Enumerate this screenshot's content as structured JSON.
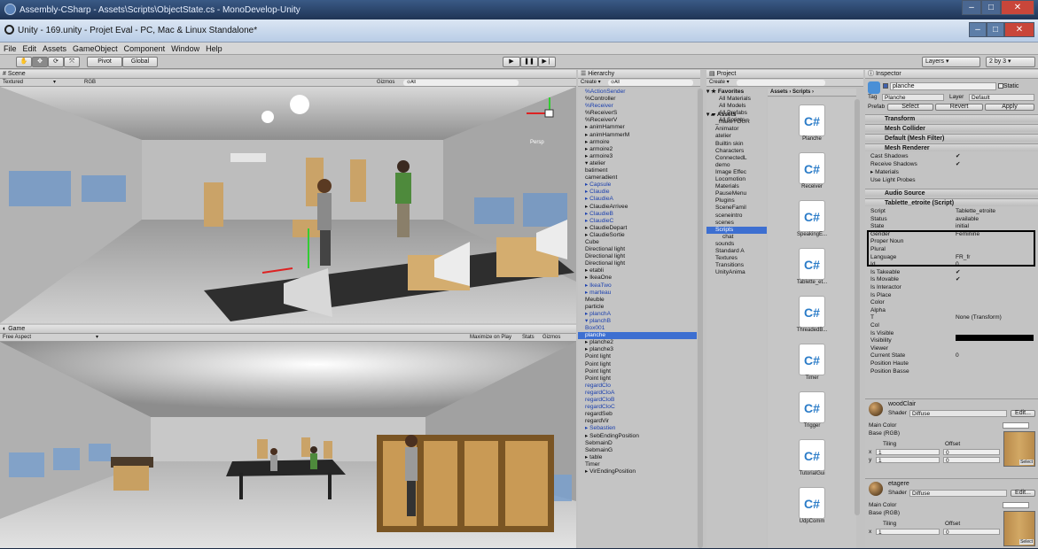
{
  "monodevelop": {
    "title": "Assembly-CSharp - Assets\\Scripts\\ObjectState.cs - MonoDevelop-Unity"
  },
  "unity": {
    "title": "Unity - 169.unity - Projet Eval - PC, Mac & Linux Standalone*",
    "menu": [
      "File",
      "Edit",
      "Assets",
      "GameObject",
      "Component",
      "Window",
      "Help"
    ],
    "toolbar": {
      "pivot": "Pivot",
      "global": "Global",
      "layers": "Layers",
      "layout": "2 by 3"
    }
  },
  "scene": {
    "tab": "Scene",
    "shading": "Textured",
    "render": "RGB",
    "gizmos": "Gizmos",
    "search": "All",
    "persp": "Persp"
  },
  "game": {
    "tab": "Game",
    "aspect": "Free Aspect",
    "maximize": "Maximize on Play",
    "stats": "Stats",
    "gizmos": "Gizmos"
  },
  "hierarchy": {
    "tab": "Hierarchy",
    "create": "Create",
    "search": "All",
    "items": [
      {
        "label": "%ActionSender",
        "style": "blue"
      },
      {
        "label": "%Controller",
        "style": "normal"
      },
      {
        "label": "%Receiver",
        "style": "blue"
      },
      {
        "label": "%ReceiverS",
        "style": "normal"
      },
      {
        "label": "%ReceiverV",
        "style": "normal"
      },
      {
        "label": "▸ animHammer",
        "style": "normal"
      },
      {
        "label": "▸ animHammerM",
        "style": "normal"
      },
      {
        "label": "▸ armoire",
        "style": "normal"
      },
      {
        "label": "▸ armoire2",
        "style": "normal"
      },
      {
        "label": "▸ armoire3",
        "style": "normal"
      },
      {
        "label": "▾ atelier",
        "style": "normal"
      },
      {
        "label": "   batiment",
        "style": "normal"
      },
      {
        "label": "   cameradient",
        "style": "normal"
      },
      {
        "label": "▸ Capsule",
        "style": "blue"
      },
      {
        "label": "▸ Claudie",
        "style": "blue"
      },
      {
        "label": "▸ ClaudieA",
        "style": "blue"
      },
      {
        "label": "▸ ClaudieArrivee",
        "style": "normal"
      },
      {
        "label": "▸ ClaudieB",
        "style": "blue"
      },
      {
        "label": "▸ ClaudieC",
        "style": "blue"
      },
      {
        "label": "▸ ClaudieDepart",
        "style": "normal"
      },
      {
        "label": "▸ ClaudieSortie",
        "style": "normal"
      },
      {
        "label": "Cube",
        "style": "normal"
      },
      {
        "label": "Directional light",
        "style": "normal"
      },
      {
        "label": "Directional light",
        "style": "normal"
      },
      {
        "label": "Directional light",
        "style": "normal"
      },
      {
        "label": "▸ etabli",
        "style": "normal"
      },
      {
        "label": "▸ IkeaOne",
        "style": "normal"
      },
      {
        "label": "▸ IkeaTwo",
        "style": "blue"
      },
      {
        "label": "▸ marteau",
        "style": "blue"
      },
      {
        "label": "Meuble",
        "style": "normal"
      },
      {
        "label": "particle",
        "style": "normal"
      },
      {
        "label": "▸ planchA",
        "style": "blue"
      },
      {
        "label": "▾ planchB",
        "style": "blue"
      },
      {
        "label": "   Box001",
        "style": "blue"
      },
      {
        "label": "planche",
        "style": "sel"
      },
      {
        "label": "▸ planche2",
        "style": "normal"
      },
      {
        "label": "▸ planche3",
        "style": "normal"
      },
      {
        "label": "Point light",
        "style": "normal"
      },
      {
        "label": "Point light",
        "style": "normal"
      },
      {
        "label": "Point light",
        "style": "normal"
      },
      {
        "label": "Point light",
        "style": "normal"
      },
      {
        "label": "regardClo",
        "style": "blue"
      },
      {
        "label": "regardCloA",
        "style": "blue"
      },
      {
        "label": "regardCloB",
        "style": "blue"
      },
      {
        "label": "regardCloC",
        "style": "blue"
      },
      {
        "label": "regardSeb",
        "style": "normal"
      },
      {
        "label": "regardVir",
        "style": "normal"
      },
      {
        "label": "▸ Sebastien",
        "style": "blue"
      },
      {
        "label": "▸ SebEndingPosition",
        "style": "normal"
      },
      {
        "label": "SebmainD",
        "style": "normal"
      },
      {
        "label": "SebmainG",
        "style": "normal"
      },
      {
        "label": "▸ table",
        "style": "normal"
      },
      {
        "label": "Timer",
        "style": "normal"
      },
      {
        "label": "▸ VirEndingPosition",
        "style": "normal"
      }
    ]
  },
  "project": {
    "tab": "Project",
    "create": "Create",
    "breadcrumb": "Assets › Scripts ›",
    "favorites": {
      "label": "Favorites",
      "items": [
        "All Materials",
        "All Models",
        "All Prefabs",
        "All Scripts"
      ]
    },
    "assets": {
      "label": "Assets",
      "items": [
        "_makeYOUR",
        "Animator",
        "atelier",
        "Builtin skin",
        "Characters",
        "ConnectedL",
        "demo",
        "Image Effec",
        "Locomotion",
        "Materials",
        "PauseMenu",
        "Plugins",
        "SceneFamil",
        "sceneintro",
        "scenes",
        "Scripts",
        "chat",
        "sounds",
        "Standard A",
        "Textures",
        "Transitions",
        "UnityAnima"
      ]
    },
    "files": [
      "Planche",
      "Receiver",
      "SpeakingE...",
      "Tablette_et...",
      "ThreadedB...",
      "Timer",
      "Trigger",
      "TutorialGui",
      "UdpComm"
    ]
  },
  "inspector": {
    "tab": "Inspector",
    "object": "planche",
    "static": "Static",
    "tag_label": "Tag",
    "tag": "Planche",
    "layer_label": "Layer",
    "layer": "Default",
    "prefab_label": "Prefab",
    "prefab_buttons": [
      "Select",
      "Revert",
      "Apply"
    ],
    "components": [
      "Transform",
      "Mesh Collider",
      "Default (Mesh Filter)",
      "Mesh Renderer",
      "Audio Source",
      "Tablette_etroite (Script)"
    ],
    "mesh_renderer": [
      {
        "label": "Cast Shadows",
        "value": "✔"
      },
      {
        "label": "Receive Shadows",
        "value": "✔"
      },
      {
        "label": "▸ Materials",
        "value": ""
      },
      {
        "label": "Use Light Probes",
        "value": ""
      }
    ],
    "script_fields": [
      {
        "label": "Script",
        "value": "Tablette_etroite"
      },
      {
        "label": "Status",
        "value": "available"
      },
      {
        "label": "State",
        "value": "initial"
      },
      {
        "label": "Gender",
        "value": "Feminine"
      },
      {
        "label": "Proper Noun",
        "value": ""
      },
      {
        "label": "Plural",
        "value": ""
      },
      {
        "label": "Language",
        "value": "FR_fr"
      },
      {
        "label": "Id",
        "value": "0"
      },
      {
        "label": "Is Takeable",
        "value": "✔"
      },
      {
        "label": "Is Movable",
        "value": "✔"
      },
      {
        "label": "Is Interactor",
        "value": ""
      },
      {
        "label": "Is Place",
        "value": ""
      },
      {
        "label": "Color",
        "value": ""
      },
      {
        "label": "Alpha",
        "value": ""
      },
      {
        "label": "T",
        "value": "None (Transform)"
      },
      {
        "label": "Col",
        "value": ""
      },
      {
        "label": "Is Visible",
        "value": ""
      },
      {
        "label": "Visibility",
        "value": ""
      },
      {
        "label": "Viewer",
        "value": ""
      },
      {
        "label": "Current State",
        "value": "0"
      },
      {
        "label": "Position Haute",
        "value": ""
      },
      {
        "label": "Position Basse",
        "value": ""
      }
    ],
    "materials": [
      {
        "name": "woodClair",
        "shader_label": "Shader",
        "shader": "Diffuse",
        "edit": "Edit...",
        "main_color": "Main Color",
        "base": "Base (RGB)",
        "tiling": "Tiling",
        "offset": "Offset",
        "x": "x",
        "y": "y",
        "t1": "1",
        "t0": "0",
        "select": "Select"
      },
      {
        "name": "etagere",
        "shader_label": "Shader",
        "shader": "Diffuse",
        "edit": "Edit...",
        "main_color": "Main Color",
        "base": "Base (RGB)",
        "tiling": "Tiling",
        "offset": "Offset",
        "x": "x",
        "t1": "1",
        "t0": "0",
        "select": "Select"
      }
    ]
  }
}
